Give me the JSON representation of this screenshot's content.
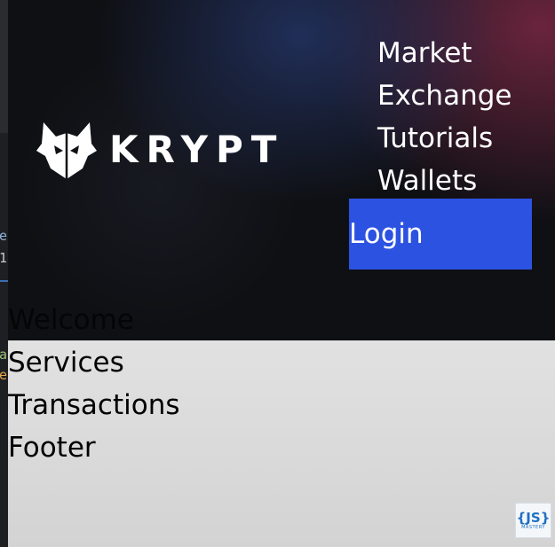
{
  "editor": {
    "glyphs": [
      "e",
      "1",
      "a",
      "e"
    ]
  },
  "brand": {
    "logo_icon": "fox-mask-icon",
    "name": "KRYPT"
  },
  "nav": {
    "items": [
      "Market",
      "Exchange",
      "Tutorials",
      "Wallets"
    ],
    "login_label": "Login"
  },
  "sections": [
    "Welcome",
    "Services",
    "Transactions",
    "Footer"
  ],
  "badge": {
    "main": "{JS}",
    "sub": "MASTERY"
  },
  "colors": {
    "accent": "#2c52e2",
    "hero_bg": "#0f1014",
    "hero_glow_purple": "#7a2844",
    "hero_glow_blue": "#26386e",
    "page_bg": "#e4e4e4"
  }
}
